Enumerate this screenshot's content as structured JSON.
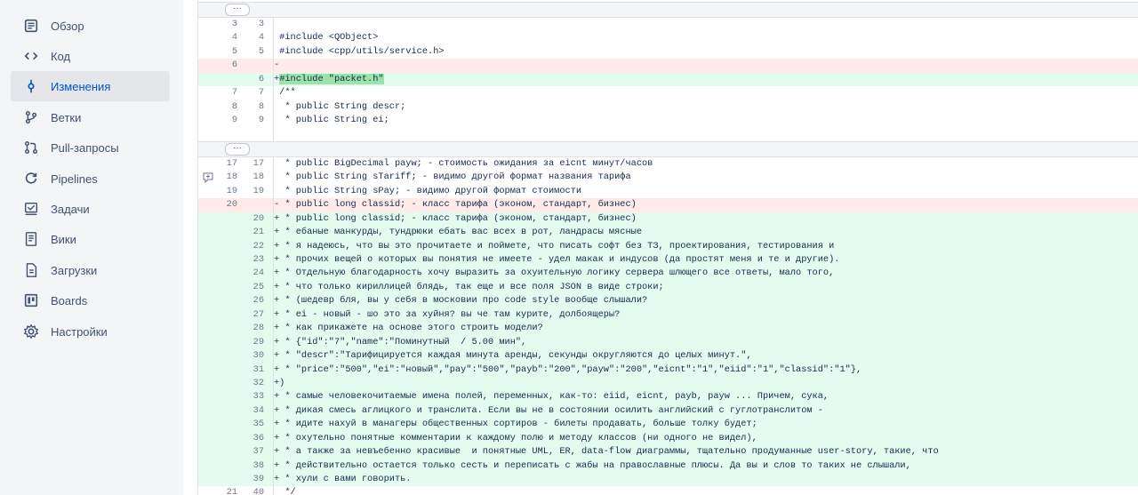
{
  "sidebar": {
    "items": [
      {
        "label": "Обзор",
        "icon": "overview-icon",
        "active": false
      },
      {
        "label": "Код",
        "icon": "code-icon",
        "active": false
      },
      {
        "label": "Изменения",
        "icon": "commit-icon",
        "active": true
      },
      {
        "label": "Ветки",
        "icon": "branch-icon",
        "active": false
      },
      {
        "label": "Pull-запросы",
        "icon": "pull-request-icon",
        "active": false
      },
      {
        "label": "Pipelines",
        "icon": "pipelines-icon",
        "active": false
      },
      {
        "label": "Задачи",
        "icon": "tasks-icon",
        "active": false
      },
      {
        "label": "Вики",
        "icon": "wiki-icon",
        "active": false
      },
      {
        "label": "Загрузки",
        "icon": "downloads-icon",
        "active": false
      },
      {
        "label": "Boards",
        "icon": "boards-icon",
        "active": false
      },
      {
        "label": "Настройки",
        "icon": "settings-icon",
        "active": false
      }
    ]
  },
  "diff": {
    "expand_label": "···",
    "hunk1": [
      {
        "t": "ctx",
        "o": "3",
        "n": "3",
        "c": ""
      },
      {
        "t": "ctx",
        "o": "4",
        "n": "4",
        "c": " #include <QObject>"
      },
      {
        "t": "ctx",
        "o": "5",
        "n": "5",
        "c": " #include <cpp/utils/service.h>"
      },
      {
        "t": "del",
        "o": "6",
        "n": "",
        "c": "-"
      },
      {
        "t": "add",
        "o": "",
        "n": "6",
        "c": "+",
        "hl": "#include \"packet.h\""
      },
      {
        "t": "ctx",
        "o": "7",
        "n": "7",
        "c": " /**"
      },
      {
        "t": "ctx",
        "o": "8",
        "n": "8",
        "c": "  * public String descr;"
      },
      {
        "t": "ctx",
        "o": "9",
        "n": "9",
        "c": "  * public String ei;"
      },
      {
        "t": "ctx",
        "o": "",
        "n": "",
        "c": ""
      }
    ],
    "hunk2": [
      {
        "t": "ctx",
        "o": "17",
        "n": "17",
        "c": "  * public BigDecimal payw; - стоимость ожидания за eicnt минут/часов"
      },
      {
        "t": "ctx",
        "o": "18",
        "n": "18",
        "c": "  * public String sTariff; - видимо другой формат названия тарифа",
        "comment": true
      },
      {
        "t": "ctx",
        "o": "19",
        "n": "19",
        "c": "  * public String sPay; - видимо другой формат стоимости"
      },
      {
        "t": "del",
        "o": "20",
        "n": "",
        "c": "- * public long classid; - класс тарифа (эконом, стандарт, бизнес)"
      },
      {
        "t": "add",
        "o": "",
        "n": "20",
        "c": "+ * public long classid; - класс тарифа (эконом, стандарт, бизнес)"
      },
      {
        "t": "add",
        "o": "",
        "n": "21",
        "c": "+ * ебаные манкурды, тундрюки ебать вас всех в рот, ландрасы мясные"
      },
      {
        "t": "add",
        "o": "",
        "n": "22",
        "c": "+ * я надеюсь, что вы это прочитаете и поймете, что писать софт без ТЗ, проектирования, тестирования и"
      },
      {
        "t": "add",
        "o": "",
        "n": "23",
        "c": "+ * прочих вещей о которых вы понятия не имеете - удел макак и индусов (да простят меня и те и другие)."
      },
      {
        "t": "add",
        "o": "",
        "n": "24",
        "c": "+ * Отдельную благодарность хочу выразить за охуительную логику сервера шлющего все ответы, мало того,"
      },
      {
        "t": "add",
        "o": "",
        "n": "25",
        "c": "+ * что только кириллицей блядь, так еще и все поля JSON в виде строки;"
      },
      {
        "t": "add",
        "o": "",
        "n": "26",
        "c": "+ * (шедевр бля, вы у себя в московии про code style вообще слышали?"
      },
      {
        "t": "add",
        "o": "",
        "n": "27",
        "c": "+ * ei - новый - шо это за хуйня? вы че там курите, долбоящеры?"
      },
      {
        "t": "add",
        "o": "",
        "n": "28",
        "c": "+ * как прикажете на основе этого строить модели?"
      },
      {
        "t": "add",
        "o": "",
        "n": "29",
        "c": "+ * {\"id\":\"7\",\"name\":\"Поминутный  / 5.00 мин\","
      },
      {
        "t": "add",
        "o": "",
        "n": "30",
        "c": "+ * \"descr\":\"Тарифицируется каждая минута аренды, секунды округляются до целых минут.\","
      },
      {
        "t": "add",
        "o": "",
        "n": "31",
        "c": "+ * \"price\":\"500\",\"ei\":\"новый\",\"pay\":\"500\",\"payb\":\"200\",\"payw\":\"200\",\"eicnt\":\"1\",\"eiid\":\"1\",\"classid\":\"1\"},"
      },
      {
        "t": "add",
        "o": "",
        "n": "32",
        "c": "+)"
      },
      {
        "t": "add",
        "o": "",
        "n": "33",
        "c": "+ * самые человекочитаемые имена полей, переменных, как-то: eiid, eicnt, payb, payw ... Причем, сука,"
      },
      {
        "t": "add",
        "o": "",
        "n": "34",
        "c": "+ * дикая смесь аглицкого и транслита. Если вы не в состоянии осилить английский с гуглотранслитом -"
      },
      {
        "t": "add",
        "o": "",
        "n": "35",
        "c": "+ * идите нахуй в манагеры общественных сортиров - билеты продавать, больше толку будет;"
      },
      {
        "t": "add",
        "o": "",
        "n": "36",
        "c": "+ * охутельно понятные комментарии к каждому полю и методу классов (ни одного не видел),"
      },
      {
        "t": "add",
        "o": "",
        "n": "37",
        "c": "+ * а также за невъебенно красивые  и понятные UML, ER, data-flow диаграммы, тщательно продуманные user-story, такие, что"
      },
      {
        "t": "add",
        "o": "",
        "n": "38",
        "c": "+ * действительно остается только сесть и переписать с жабы на православные плюсы. Да вы и слов то таких не слышали,"
      },
      {
        "t": "add",
        "o": "",
        "n": "39",
        "c": "+ * хули с вами говорить."
      },
      {
        "t": "ctx",
        "o": "21",
        "n": "40",
        "c": "  */"
      }
    ]
  }
}
